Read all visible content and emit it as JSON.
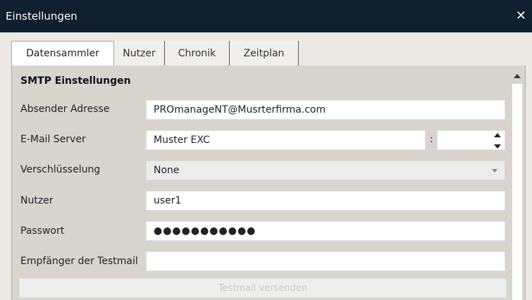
{
  "window": {
    "title": "Einstellungen",
    "close_glyph": "✕"
  },
  "tabs": [
    {
      "label": "Datensammler"
    },
    {
      "label": "Nutzer"
    },
    {
      "label": "Chronik"
    },
    {
      "label": "Zeitplan"
    }
  ],
  "active_tab": "Datensammler",
  "smtp": {
    "section_title": "SMTP Einstellungen",
    "sender_label": "Absender Adresse",
    "sender_value": "PROmanageNT@Musrterfirma.com",
    "server_label": "E-Mail Server",
    "server_value": "Muster EXC",
    "port_separator": ":",
    "port_value": "",
    "encryption_label": "Verschlüsselung",
    "encryption_value": "None",
    "user_label": "Nutzer",
    "user_value": "user1",
    "password_label": "Passwort",
    "password_mask": "●●●●●●●●●●●",
    "recipient_label": "Empfänger der Testmail",
    "recipient_value": "",
    "send_button": "Testmail versenden"
  },
  "icons": {
    "close": "close-icon",
    "spinner_up": "spinner-up-icon",
    "spinner_down": "spinner-down-icon",
    "dropdown": "chevron-down-icon",
    "scroll_up": "scroll-up-icon"
  },
  "colors": {
    "titlebar": "#0f1f2e",
    "panel": "#d8d5cf",
    "field": "#ffffff",
    "disabled_text": "#c9c9c9"
  }
}
